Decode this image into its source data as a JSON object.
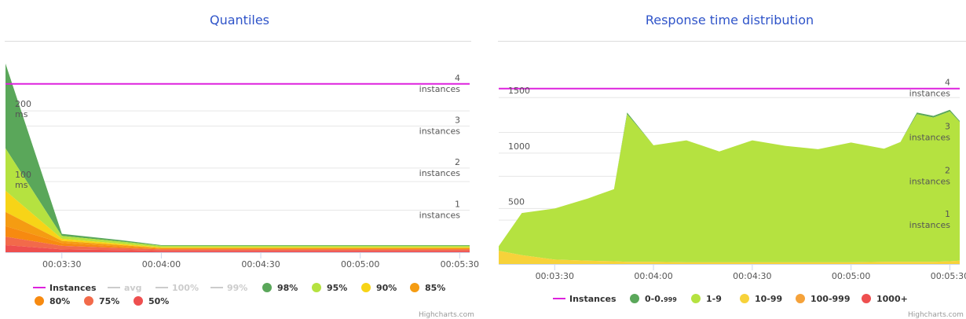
{
  "charts": [
    {
      "title": "Quantiles",
      "credit": "Highcharts.com",
      "legend": [
        {
          "label": "Instances",
          "color": "#dd22dd",
          "marker": "line",
          "active": true
        },
        {
          "label": "avg",
          "color": "#cccccc",
          "marker": "line",
          "active": false
        },
        {
          "label": "100%",
          "color": "#cccccc",
          "marker": "line",
          "active": false
        },
        {
          "label": "99%",
          "color": "#cccccc",
          "marker": "line",
          "active": false
        },
        {
          "label": "98%",
          "color": "#5aa75a",
          "marker": "dot",
          "active": true
        },
        {
          "label": "95%",
          "color": "#b5e240",
          "marker": "dot",
          "active": true
        },
        {
          "label": "90%",
          "color": "#f7d417",
          "marker": "dot",
          "active": true
        },
        {
          "label": "85%",
          "color": "#f59c12",
          "marker": "dot",
          "active": true
        },
        {
          "label": "80%",
          "color": "#f78a10",
          "marker": "dot",
          "active": true
        },
        {
          "label": "75%",
          "color": "#f26a4a",
          "marker": "dot",
          "active": true
        },
        {
          "label": "50%",
          "color": "#ee4f4f",
          "marker": "dot",
          "active": true
        }
      ]
    },
    {
      "title": "Response time distribution",
      "credit": "Highcharts.com",
      "legend": [
        {
          "label": "Instances",
          "color": "#dd22dd",
          "marker": "line",
          "active": true
        },
        {
          "label": "0-0.",
          "sub": "999",
          "color": "#5aa75a",
          "marker": "dot",
          "active": true
        },
        {
          "label": "1-9",
          "color": "#b5e240",
          "marker": "dot",
          "active": true
        },
        {
          "label": "10-99",
          "color": "#f7d23a",
          "marker": "dot",
          "active": true
        },
        {
          "label": "100-999",
          "color": "#f5a23a",
          "marker": "dot",
          "active": true
        },
        {
          "label": "1000+",
          "color": "#ee4f4f",
          "marker": "dot",
          "active": true
        }
      ]
    }
  ],
  "chart_data": [
    {
      "type": "area",
      "title": "Quantiles",
      "x": [
        "00:03:13",
        "00:03:30",
        "00:03:48",
        "00:04:00",
        "00:04:12",
        "00:04:30",
        "00:04:48",
        "00:05:00",
        "00:05:12",
        "00:05:30",
        "00:05:33"
      ],
      "xticks": [
        "00:03:30",
        "00:04:00",
        "00:04:30",
        "00:05:00",
        "00:05:30"
      ],
      "y_ticks": [
        {
          "value": 100,
          "label": "100",
          "unit": "ms"
        },
        {
          "value": 200,
          "label": "200",
          "unit": "ms"
        }
      ],
      "y_unit": "ms",
      "ylim": [
        0,
        268
      ],
      "y2_ticks": [
        {
          "value": 1,
          "label": "1",
          "unit": "instances"
        },
        {
          "value": 2,
          "label": "2",
          "unit": "instances"
        },
        {
          "value": 3,
          "label": "3",
          "unit": "instances"
        },
        {
          "value": 4,
          "label": "4",
          "unit": "instances"
        }
      ],
      "y2lim": [
        0,
        4.5
      ],
      "stacked": true,
      "series": [
        {
          "name": "50%",
          "color": "#ee4f4f",
          "values": [
            10,
            4,
            3,
            2,
            2,
            2,
            2,
            2,
            2,
            2,
            2
          ]
        },
        {
          "name": "75%",
          "color": "#f26a4a",
          "values": [
            12,
            5,
            3,
            2,
            2,
            2,
            2,
            2,
            2,
            2,
            2
          ]
        },
        {
          "name": "80%",
          "color": "#f78a10",
          "values": [
            15,
            4,
            2,
            1,
            1,
            1,
            1,
            1,
            1,
            1,
            1
          ]
        },
        {
          "name": "85%",
          "color": "#f59c12",
          "values": [
            20,
            3,
            2,
            1,
            1,
            1,
            1,
            1,
            1,
            1,
            1
          ]
        },
        {
          "name": "90%",
          "color": "#f7d417",
          "values": [
            30,
            3,
            2,
            1,
            1,
            1,
            1,
            1,
            1,
            1,
            1
          ]
        },
        {
          "name": "95%",
          "color": "#b5e240",
          "values": [
            60,
            4,
            3,
            2,
            2,
            2,
            2,
            2,
            2,
            2,
            2
          ]
        },
        {
          "name": "98%",
          "color": "#5aa75a",
          "values": [
            120,
            3,
            2,
            1,
            1,
            1,
            1,
            1,
            1,
            1,
            1
          ]
        }
      ],
      "instances": {
        "name": "Instances",
        "color": "#dd22dd",
        "values": [
          4,
          4,
          4,
          4,
          4,
          4,
          4,
          4,
          4,
          4,
          4
        ]
      },
      "grid": true,
      "legend_position": "bottom"
    },
    {
      "type": "area",
      "title": "Response time distribution",
      "x": [
        "00:03:13",
        "00:03:20",
        "00:03:30",
        "00:03:40",
        "00:03:48",
        "00:03:52",
        "00:04:00",
        "00:04:10",
        "00:04:20",
        "00:04:30",
        "00:04:40",
        "00:04:50",
        "00:05:00",
        "00:05:10",
        "00:05:15",
        "00:05:20",
        "00:05:25",
        "00:05:30",
        "00:05:33"
      ],
      "xticks": [
        "00:03:30",
        "00:04:00",
        "00:04:30",
        "00:05:00",
        "00:05:30"
      ],
      "y_ticks": [
        {
          "value": 500,
          "label": "500"
        },
        {
          "value": 1000,
          "label": "1000"
        },
        {
          "value": 1500,
          "label": "1500"
        }
      ],
      "ylim": [
        0,
        1700
      ],
      "y2_ticks": [
        {
          "value": 1,
          "label": "1",
          "unit": "instances"
        },
        {
          "value": 2,
          "label": "2",
          "unit": "instances"
        },
        {
          "value": 3,
          "label": "3",
          "unit": "instances"
        },
        {
          "value": 4,
          "label": "4",
          "unit": "instances"
        }
      ],
      "y2lim": [
        0,
        4.3
      ],
      "stacked": true,
      "series": [
        {
          "name": "1000+",
          "color": "#ee4f4f",
          "values": [
            0,
            0,
            0,
            0,
            0,
            0,
            0,
            0,
            0,
            0,
            0,
            0,
            0,
            0,
            0,
            0,
            0,
            0,
            0
          ]
        },
        {
          "name": "100-999",
          "color": "#f5a23a",
          "values": [
            0,
            0,
            0,
            0,
            0,
            0,
            0,
            0,
            0,
            0,
            0,
            0,
            0,
            0,
            0,
            0,
            0,
            0,
            0
          ]
        },
        {
          "name": "10-99",
          "color": "#f7d23a",
          "values": [
            120,
            80,
            40,
            30,
            25,
            20,
            20,
            15,
            15,
            15,
            15,
            15,
            15,
            20,
            20,
            20,
            20,
            25,
            30
          ]
        },
        {
          "name": "1-9",
          "color": "#b5e240",
          "values": [
            40,
            380,
            460,
            560,
            650,
            1330,
            1050,
            1100,
            1000,
            1100,
            1050,
            1020,
            1080,
            1020,
            1080,
            1330,
            1300,
            1350,
            1250
          ]
        },
        {
          "name": "0-0.999",
          "color": "#5aa75a",
          "values": [
            0,
            0,
            0,
            0,
            0,
            15,
            0,
            0,
            0,
            0,
            0,
            0,
            0,
            0,
            0,
            15,
            15,
            15,
            10
          ]
        }
      ],
      "instances": {
        "name": "Instances",
        "color": "#dd22dd",
        "values": [
          4,
          4,
          4,
          4,
          4,
          4,
          4,
          4,
          4,
          4,
          4,
          4,
          4,
          4,
          4,
          4,
          4,
          4,
          4
        ]
      },
      "grid": true,
      "legend_position": "bottom"
    }
  ]
}
